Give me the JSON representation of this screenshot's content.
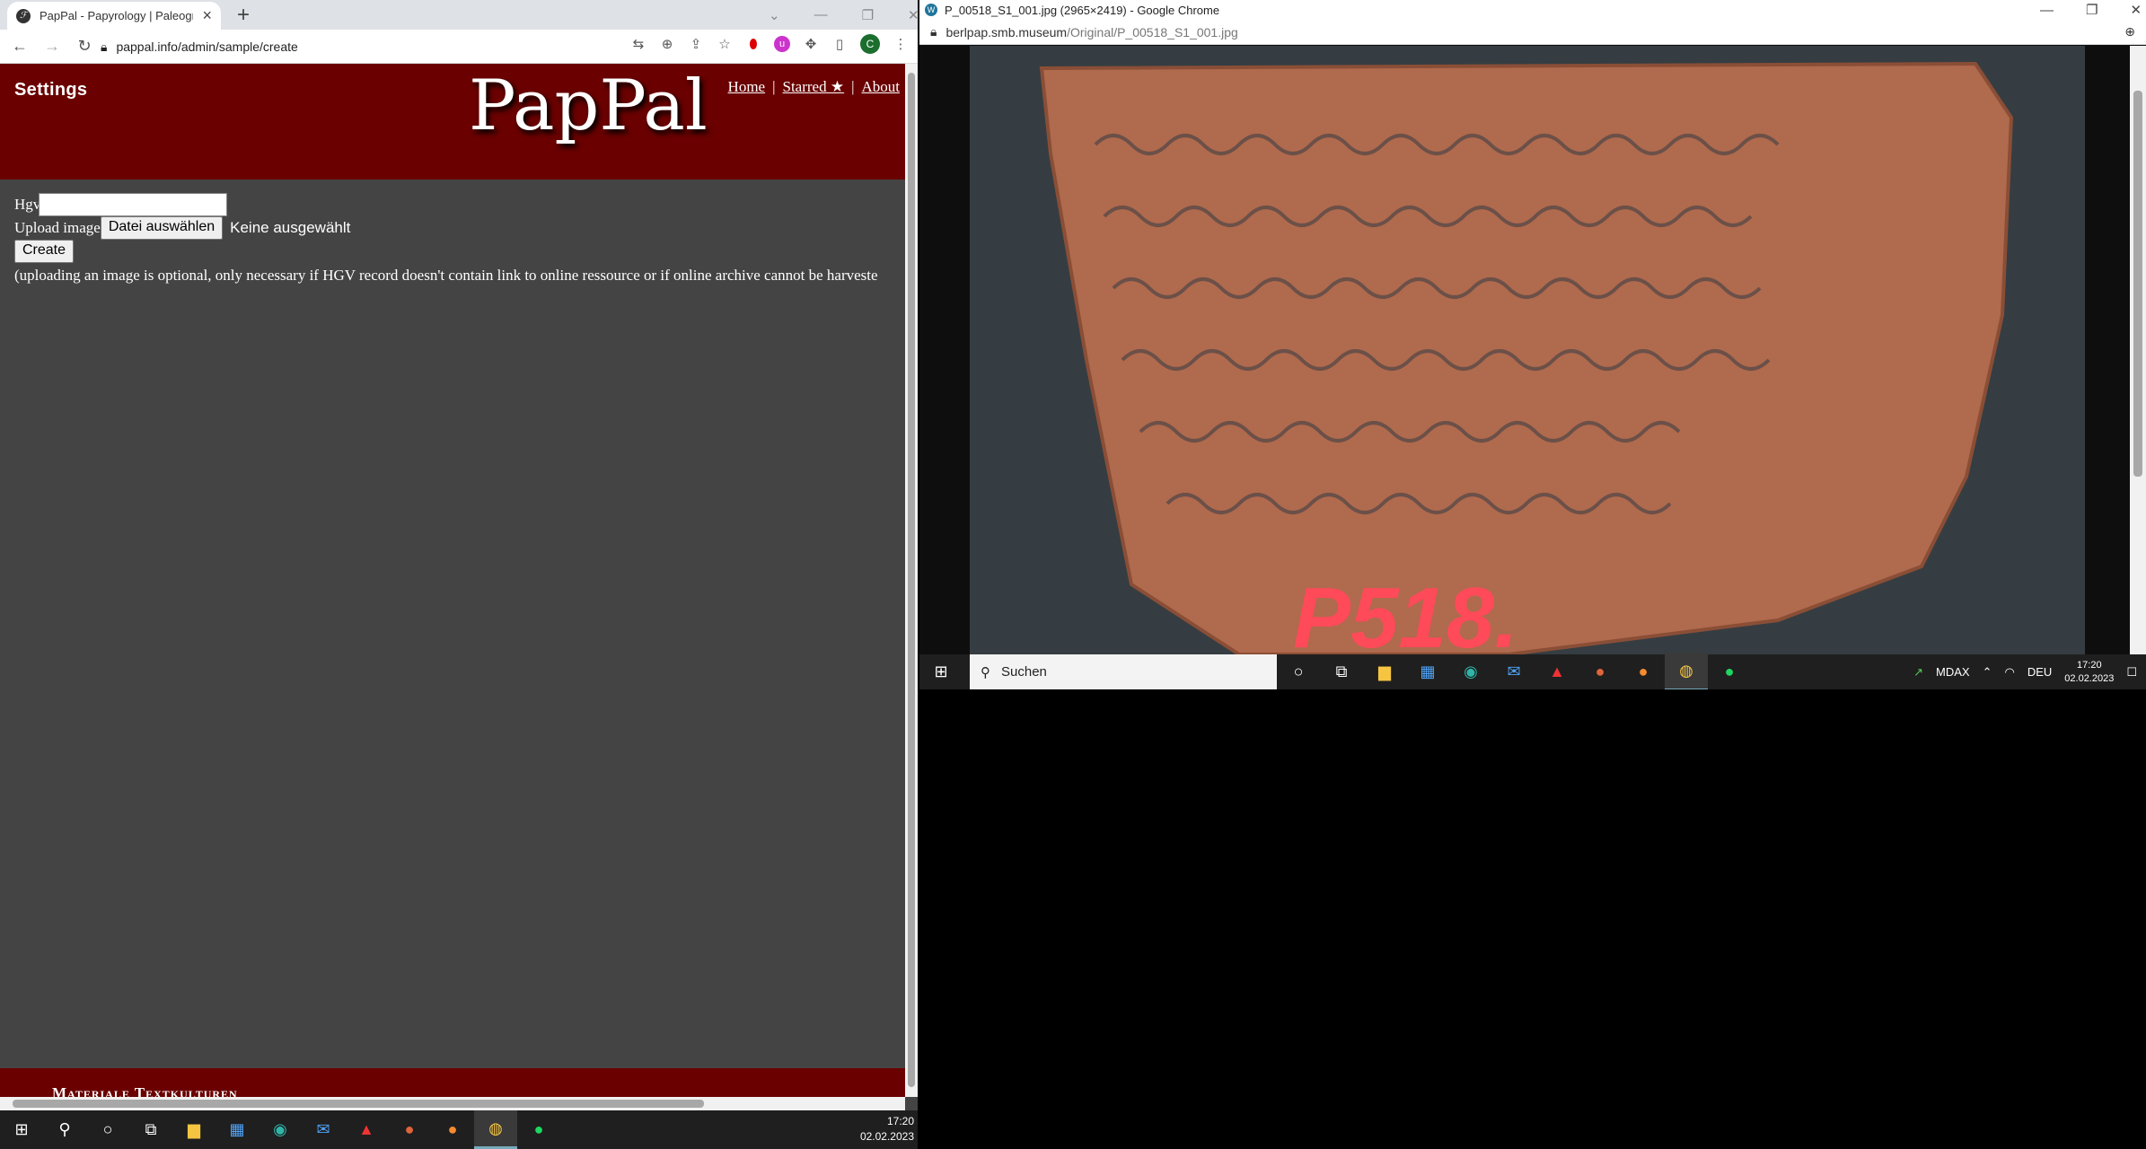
{
  "left_window": {
    "tab_title": "PapPal - Papyrology | Paleograph",
    "url": "pappal.info/admin/sample/create",
    "page": {
      "settings_label": "Settings",
      "logo": "PapPal",
      "nav_links": [
        "Home",
        "Starred ★",
        "About"
      ],
      "nav_separator": "|",
      "hgv_label": "Hgv",
      "hgv_value": "",
      "upload_label": "Upload image",
      "choose_file_button": "Datei auswählen",
      "no_file_text": "Keine ausgewählt",
      "create_button": "Create",
      "note": "(uploading an image is optional, only necessary if HGV record doesn't contain link to online ressource or if online archive cannot be harveste",
      "footer_text": "Materiale Textkulturen"
    }
  },
  "right_window": {
    "title": "P_00518_S1_001.jpg (2965×2419) - Google Chrome",
    "url_domain": "berlpap.smb.museum",
    "url_path": "/Original/P_00518_S1_001.jpg",
    "image_label": "P518.",
    "taskbar": {
      "search_placeholder": "Suchen",
      "tray_stock": "MDAX",
      "language": "DEU",
      "time": "17:20",
      "date": "02.02.2023"
    }
  },
  "taskbar": {
    "time": "17:20",
    "date": "02.02.2023"
  },
  "colors": {
    "header_red": "#6a0000",
    "page_gray": "#444444",
    "ostracon": "#b36a4c"
  }
}
